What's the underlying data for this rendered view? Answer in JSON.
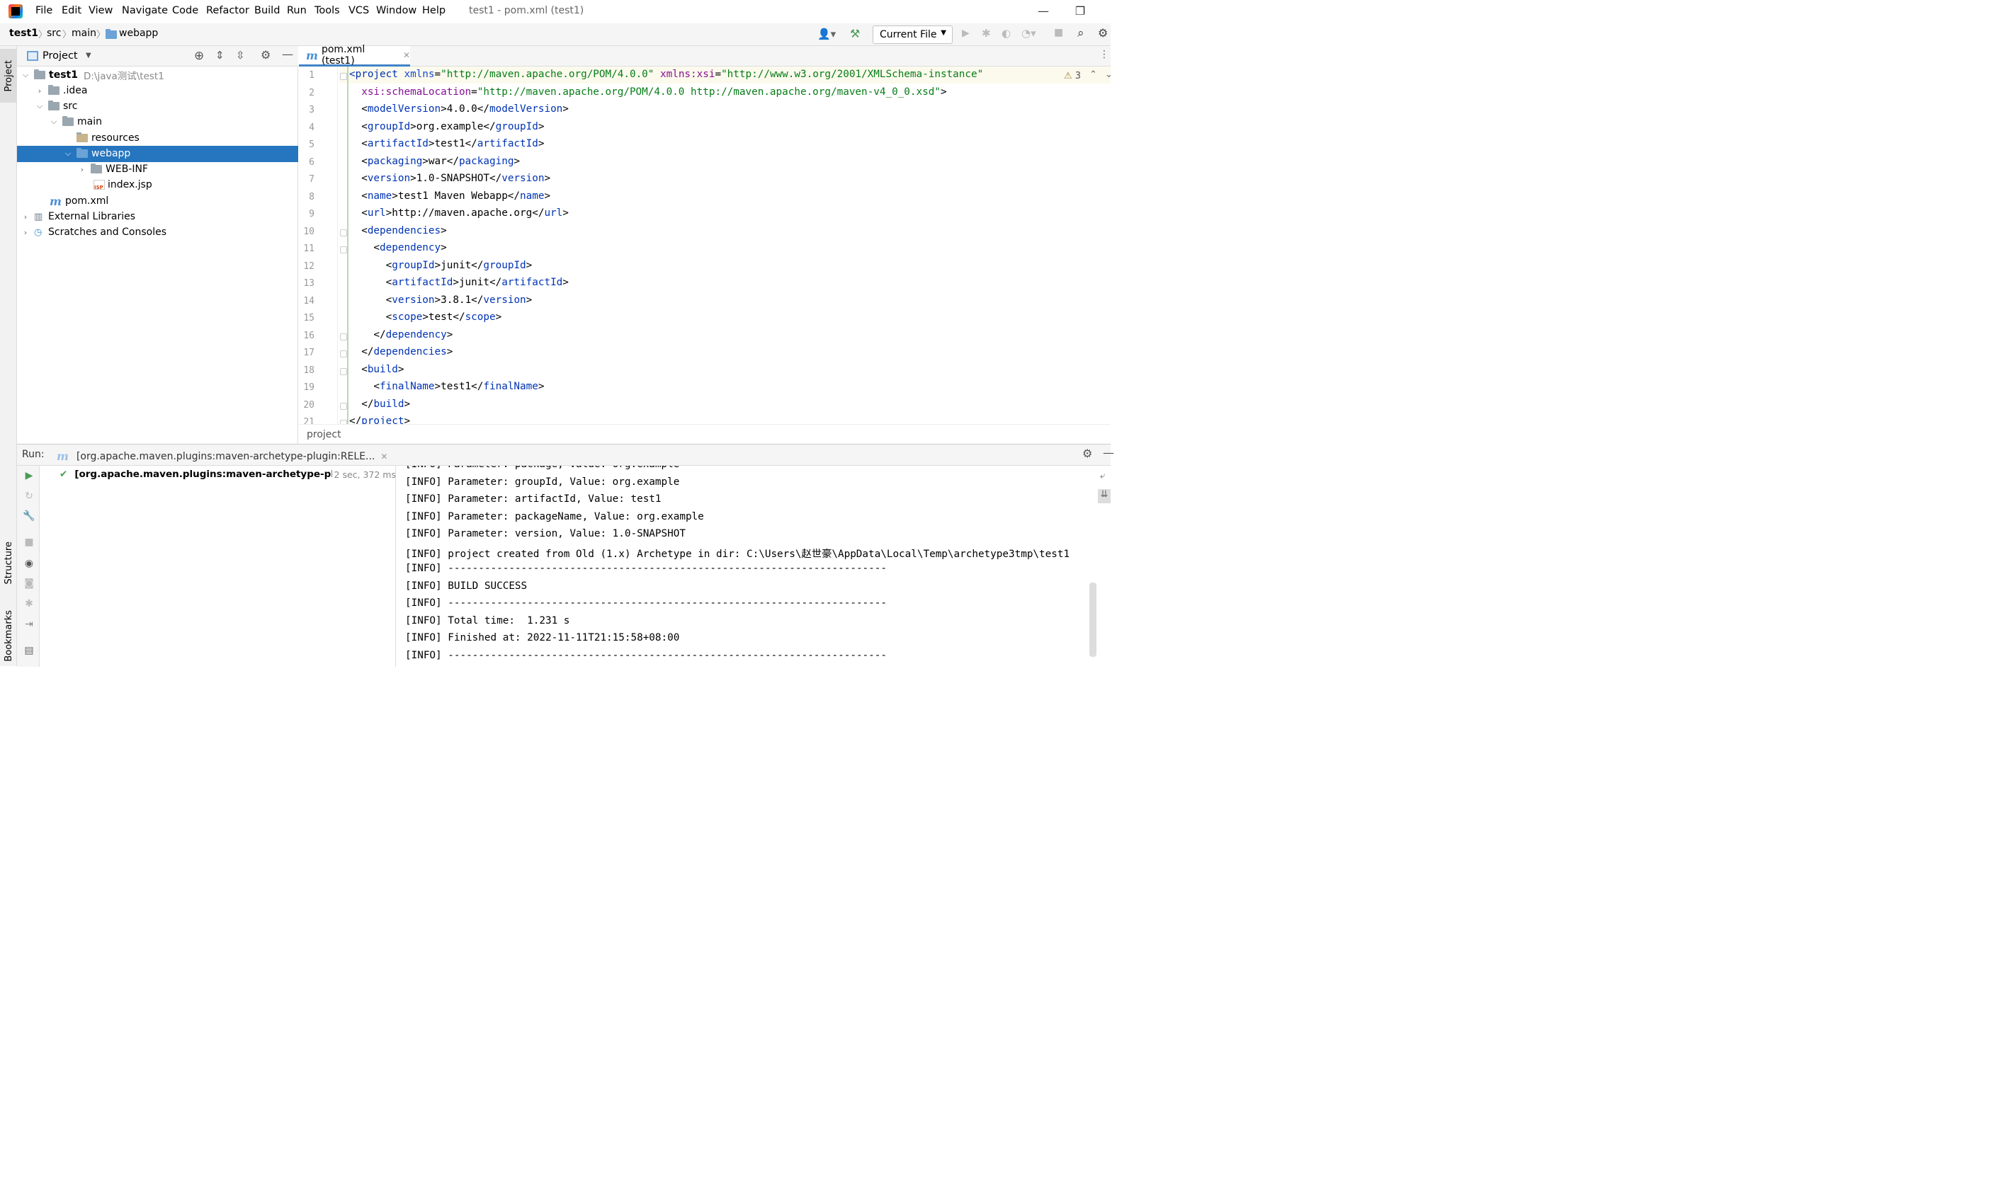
{
  "window": {
    "title": "test1 - pom.xml (test1)",
    "menu": [
      "File",
      "Edit",
      "View",
      "Navigate",
      "Code",
      "Refactor",
      "Build",
      "Run",
      "Tools",
      "VCS",
      "Window",
      "Help"
    ],
    "controls": [
      "—",
      "❐"
    ]
  },
  "breadcrumb": [
    "test1",
    "src",
    "main",
    "webapp"
  ],
  "toolbar": {
    "run_config": "Current File"
  },
  "sidebar": {
    "project_tab": "Project",
    "structure_tab": "Structure",
    "bookmarks_tab": "Bookmarks"
  },
  "project_panel": {
    "title": "Project",
    "tree": [
      {
        "label": "test1",
        "extra": "D:\\java测试\\test1"
      },
      {
        "label": ".idea"
      },
      {
        "label": "src"
      },
      {
        "label": "main"
      },
      {
        "label": "resources"
      },
      {
        "label": "webapp"
      },
      {
        "label": "WEB-INF"
      },
      {
        "label": "index.jsp"
      },
      {
        "label": "pom.xml"
      },
      {
        "label": "External Libraries"
      },
      {
        "label": "Scratches and Consoles"
      }
    ]
  },
  "editor": {
    "tab_label": "pom.xml (test1)",
    "warning_count": "3",
    "footer_breadcrumb": "project",
    "line_numbers": [
      "1",
      "2",
      "3",
      "4",
      "5",
      "6",
      "7",
      "8",
      "9",
      "10",
      "11",
      "12",
      "13",
      "14",
      "15",
      "16",
      "17",
      "18",
      "19",
      "20",
      "21"
    ],
    "lines": [
      [
        [
          "tg",
          "<project "
        ],
        [
          "an",
          "xmlns"
        ],
        [
          "",
          "="
        ],
        [
          "av",
          "\"http://maven.apache.org/POM/4.0.0\""
        ],
        [
          "",
          " "
        ],
        [
          "ns",
          "xmlns:xsi"
        ],
        [
          "",
          "="
        ],
        [
          "av",
          "\"http://www.w3.org/2001/XMLSchema-instance\""
        ]
      ],
      [
        [
          "",
          "  "
        ],
        [
          "ns",
          "xsi:schemaLocation"
        ],
        [
          "",
          "="
        ],
        [
          "av",
          "\"http://maven.apache.org/POM/4.0.0 http://maven.apache.org/maven-v4_0_0.xsd\""
        ],
        [
          "",
          ">"
        ]
      ],
      [
        [
          "",
          "  <"
        ],
        [
          "tg",
          "modelVersion"
        ],
        [
          "",
          ">4.0.0</"
        ],
        [
          "tg",
          "modelVersion"
        ],
        [
          "",
          ">"
        ]
      ],
      [
        [
          "",
          "  <"
        ],
        [
          "tg",
          "groupId"
        ],
        [
          "",
          ">org.example</"
        ],
        [
          "tg",
          "groupId"
        ],
        [
          "",
          ">"
        ]
      ],
      [
        [
          "",
          "  <"
        ],
        [
          "tg",
          "artifactId"
        ],
        [
          "",
          ">test1</"
        ],
        [
          "tg",
          "artifactId"
        ],
        [
          "",
          ">"
        ]
      ],
      [
        [
          "",
          "  <"
        ],
        [
          "tg",
          "packaging"
        ],
        [
          "",
          ">war</"
        ],
        [
          "tg",
          "packaging"
        ],
        [
          "",
          ">"
        ]
      ],
      [
        [
          "",
          "  <"
        ],
        [
          "tg",
          "version"
        ],
        [
          "",
          ">1.0-SNAPSHOT</"
        ],
        [
          "tg",
          "version"
        ],
        [
          "",
          ">"
        ]
      ],
      [
        [
          "",
          "  <"
        ],
        [
          "tg",
          "name"
        ],
        [
          "",
          ">test1 Maven Webapp</"
        ],
        [
          "tg",
          "name"
        ],
        [
          "",
          ">"
        ]
      ],
      [
        [
          "",
          "  <"
        ],
        [
          "tg",
          "url"
        ],
        [
          "",
          ">http://maven.apache.org</"
        ],
        [
          "tg",
          "url"
        ],
        [
          "",
          ">"
        ]
      ],
      [
        [
          "",
          "  <"
        ],
        [
          "tg",
          "dependencies"
        ],
        [
          "",
          ">"
        ]
      ],
      [
        [
          "",
          "    <"
        ],
        [
          "tg",
          "dependency"
        ],
        [
          "",
          ">"
        ]
      ],
      [
        [
          "",
          "      <"
        ],
        [
          "tg",
          "groupId"
        ],
        [
          "",
          ">junit</"
        ],
        [
          "tg",
          "groupId"
        ],
        [
          "",
          ">"
        ]
      ],
      [
        [
          "",
          "      <"
        ],
        [
          "tg",
          "artifactId"
        ],
        [
          "",
          ">junit</"
        ],
        [
          "tg",
          "artifactId"
        ],
        [
          "",
          ">"
        ]
      ],
      [
        [
          "",
          "      <"
        ],
        [
          "tg",
          "version"
        ],
        [
          "",
          ">3.8.1</"
        ],
        [
          "tg",
          "version"
        ],
        [
          "",
          ">"
        ]
      ],
      [
        [
          "",
          "      <"
        ],
        [
          "tg",
          "scope"
        ],
        [
          "",
          ">test</"
        ],
        [
          "tg",
          "scope"
        ],
        [
          "",
          ">"
        ]
      ],
      [
        [
          "",
          "    </"
        ],
        [
          "tg",
          "dependency"
        ],
        [
          "",
          ">"
        ]
      ],
      [
        [
          "",
          "  </"
        ],
        [
          "tg",
          "dependencies"
        ],
        [
          "",
          ">"
        ]
      ],
      [
        [
          "",
          "  <"
        ],
        [
          "tg",
          "build"
        ],
        [
          "",
          ">"
        ]
      ],
      [
        [
          "",
          "    <"
        ],
        [
          "tg",
          "finalName"
        ],
        [
          "",
          ">test1</"
        ],
        [
          "tg",
          "finalName"
        ],
        [
          "",
          ">"
        ]
      ],
      [
        [
          "",
          "  </"
        ],
        [
          "tg",
          "build"
        ],
        [
          "",
          ">"
        ]
      ],
      [
        [
          "",
          "</"
        ],
        [
          "tg",
          "project"
        ],
        [
          "",
          ">"
        ]
      ]
    ]
  },
  "run": {
    "label": "Run:",
    "tab": "[org.apache.maven.plugins:maven-archetype-plugin:RELE...",
    "task_label": "[org.apache.maven.plugins:maven-archetype-plugin:F",
    "task_time": "2 sec, 372 ms",
    "console": [
      "[INFO] Parameter: package, Value: org.example",
      "[INFO] Parameter: groupId, Value: org.example",
      "[INFO] Parameter: artifactId, Value: test1",
      "[INFO] Parameter: packageName, Value: org.example",
      "[INFO] Parameter: version, Value: 1.0-SNAPSHOT",
      "[INFO] project created from Old (1.x) Archetype in dir: C:\\Users\\赵世豪\\AppData\\Local\\Temp\\archetype3tmp\\test1",
      "[INFO] ------------------------------------------------------------------------",
      "[INFO] BUILD SUCCESS",
      "[INFO] ------------------------------------------------------------------------",
      "[INFO] Total time:  1.231 s",
      "[INFO] Finished at: 2022-11-11T21:15:58+08:00",
      "[INFO] ------------------------------------------------------------------------"
    ]
  }
}
